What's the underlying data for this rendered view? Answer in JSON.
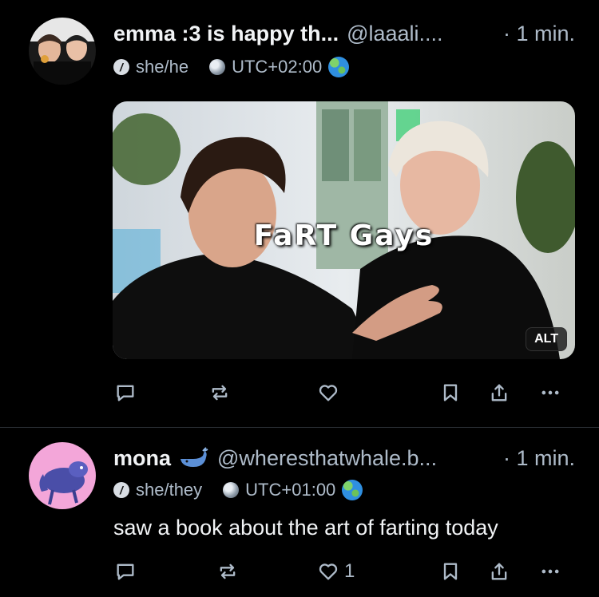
{
  "posts": [
    {
      "display_name": "emma :3 is happy th...",
      "handle": "@laaali....",
      "time": "· 1 min.",
      "pronouns": "she/he",
      "timezone": "UTC+02:00",
      "image_caption": "FaRT Gays",
      "alt_badge": "ALT",
      "actions": {
        "reply": "reply-icon",
        "repost": "repost-icon",
        "like": "heart-icon",
        "bookmark": "bookmark-icon",
        "share": "share-icon",
        "more": "more-icon"
      }
    },
    {
      "display_name": "mona",
      "name_emoji": "whale",
      "handle": "@wheresthatwhale.b...",
      "time": "· 1 min.",
      "pronouns": "she/they",
      "timezone": "UTC+01:00",
      "text": "saw a book about the art of farting today",
      "like_count": "1"
    }
  ],
  "colors": {
    "background": "#000000",
    "text": "#f1f3f5",
    "muted": "#aebbc9",
    "divider": "#2b2f35"
  }
}
